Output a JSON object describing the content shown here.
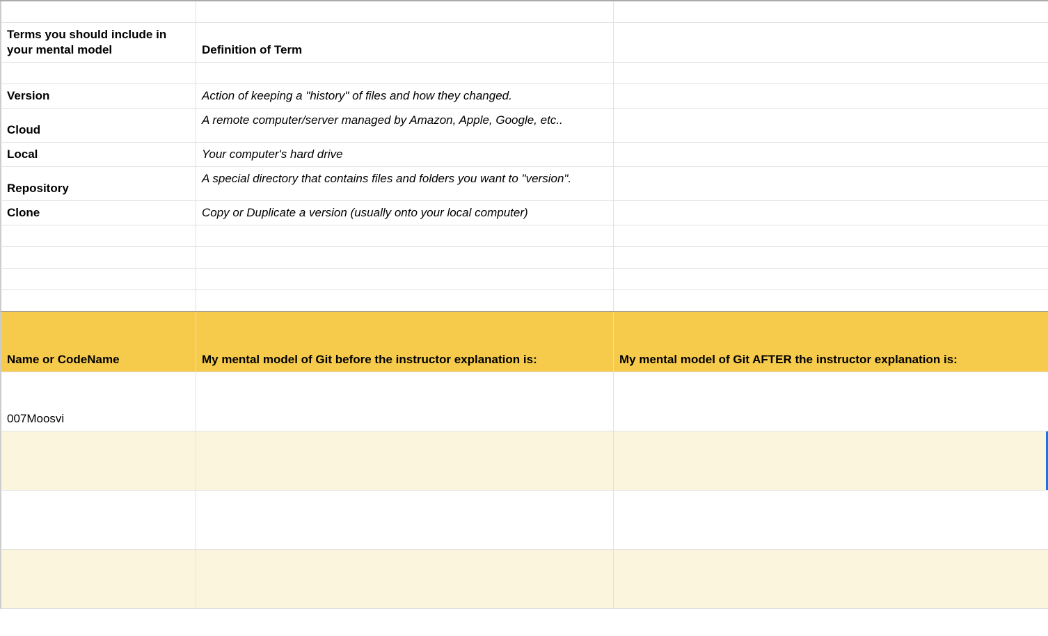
{
  "terms_header": {
    "col_a": "Terms you should include in your mental model",
    "col_b": "Definition of Term"
  },
  "terms": [
    {
      "term": "Version",
      "def": "Action of keeping a \"history\" of files and how they changed."
    },
    {
      "term": "Cloud",
      "def": "A remote computer/server managed by Amazon, Apple, Google, etc.."
    },
    {
      "term": "Local",
      "def": "Your computer's hard drive"
    },
    {
      "term": "Repository",
      "def": "A special directory that contains files and folders you want to \"version\"."
    },
    {
      "term": "Clone",
      "def": "Copy or Duplicate a version (usually onto your local computer)"
    }
  ],
  "section_header": {
    "col_a": "Name or CodeName",
    "col_b": "My mental model of Git before the instructor explanation is:",
    "col_c": "My mental model of Git AFTER the instructor explanation is:"
  },
  "entries": [
    {
      "name": "007Moosvi",
      "before": "",
      "after": ""
    },
    {
      "name": "",
      "before": "",
      "after": ""
    },
    {
      "name": "",
      "before": "",
      "after": ""
    },
    {
      "name": "",
      "before": "",
      "after": ""
    }
  ]
}
